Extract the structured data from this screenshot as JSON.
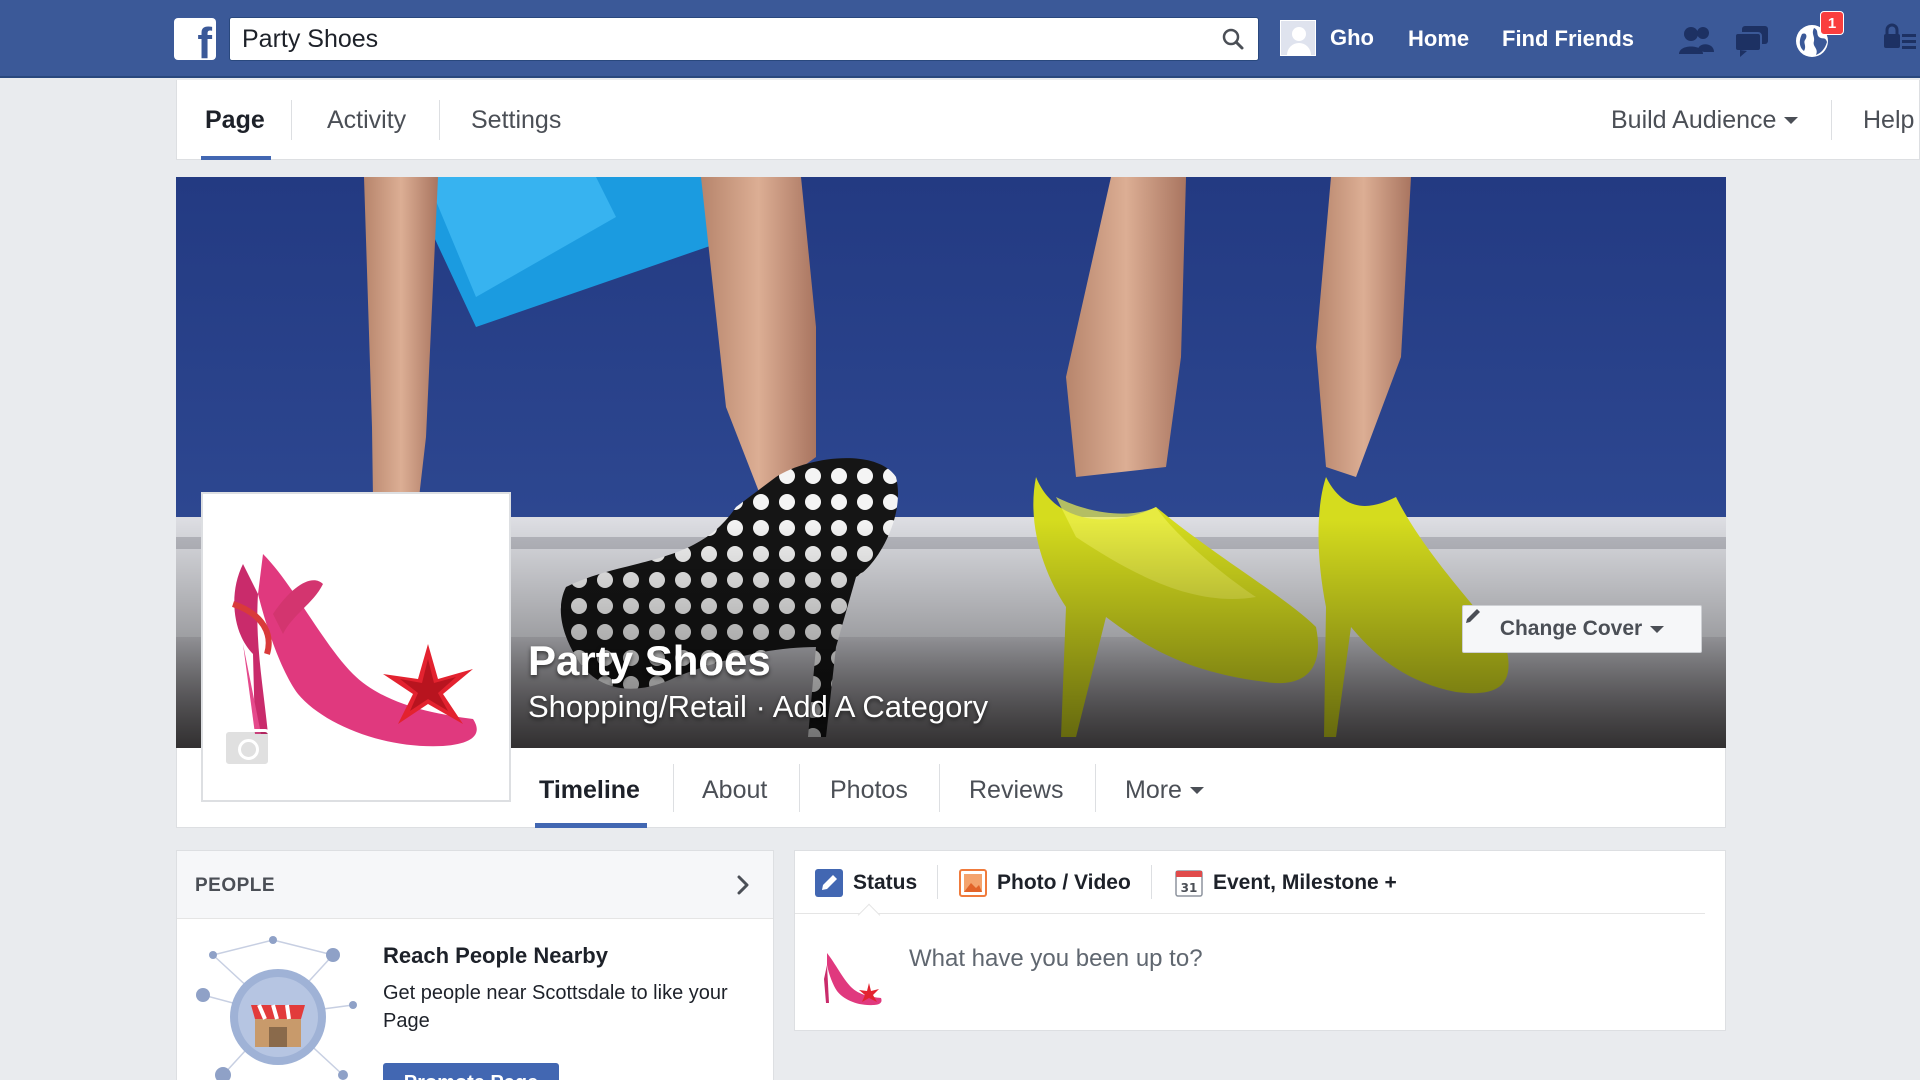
{
  "topbar": {
    "logo_icon": "facebook-logo",
    "search_value": "Party Shoes",
    "search_icon": "search-icon",
    "user_name": "Gho",
    "home_label": "Home",
    "find_friends_label": "Find Friends",
    "notification_count": "1",
    "brand_color": "#3b5998"
  },
  "admin_tabs": {
    "page": "Page",
    "activity": "Activity",
    "settings": "Settings",
    "build_audience": "Build Audience",
    "help": "Help"
  },
  "cover": {
    "page_name": "Party Shoes",
    "category_line": "Shopping/Retail · Add A Category",
    "change_cover_label": "Change Cover"
  },
  "timeline_tabs": {
    "timeline": "Timeline",
    "about": "About",
    "photos": "Photos",
    "reviews": "Reviews",
    "more": "More"
  },
  "people": {
    "header": "PEOPLE",
    "nearby_title": "Reach People Nearby",
    "nearby_description": "Get people near Scottsdale to like your Page",
    "promote_label": "Promote Page"
  },
  "composer": {
    "status_label": "Status",
    "photo_video_label": "Photo / Video",
    "event_label": "Event, Milestone +",
    "calendar_day": "31",
    "placeholder": "What have you been up to?"
  }
}
